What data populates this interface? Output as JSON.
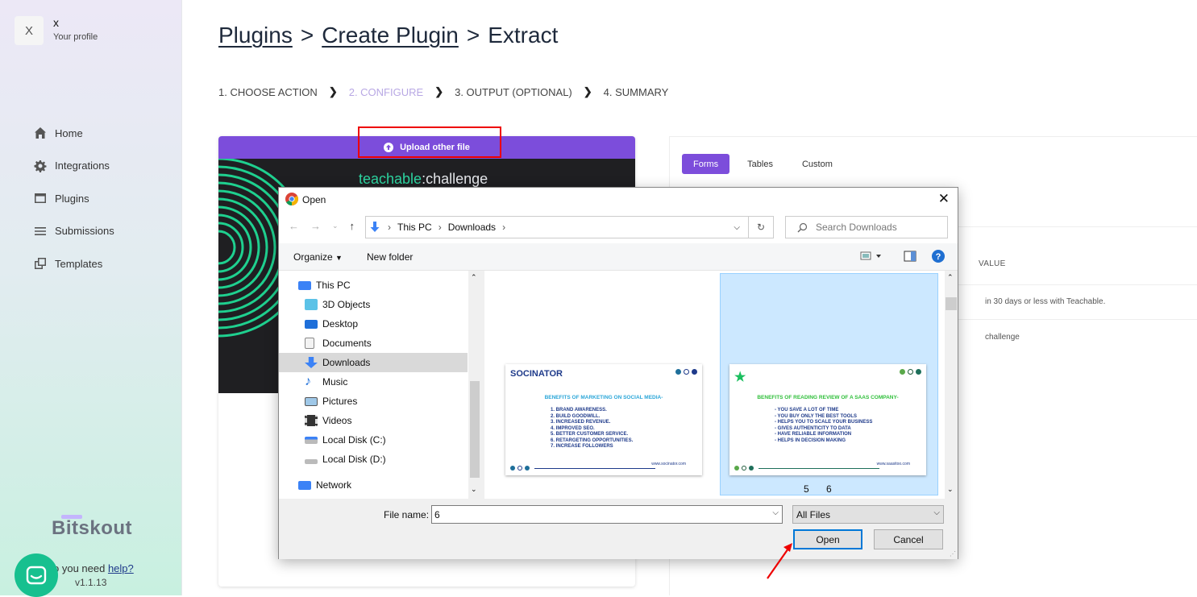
{
  "profile": {
    "initial": "X",
    "name": "x",
    "subtitle": "Your profile"
  },
  "nav": [
    {
      "label": "Home",
      "icon": "home-icon"
    },
    {
      "label": "Integrations",
      "icon": "gear-icon"
    },
    {
      "label": "Plugins",
      "icon": "window-icon"
    },
    {
      "label": "Submissions",
      "icon": "list-icon"
    },
    {
      "label": "Templates",
      "icon": "copy-icon"
    }
  ],
  "brand": "Bitskout",
  "help": {
    "prefix": "o you need ",
    "link": "help?",
    "version": "v1.1.13"
  },
  "breadcrumb": {
    "plugins": "Plugins",
    "create": "Create Plugin",
    "current": "Extract",
    "sep": ">"
  },
  "steps": [
    "1. CHOOSE ACTION",
    "2. CONFIGURE",
    "3. OUTPUT (OPTIONAL)",
    "4. SUMMARY"
  ],
  "upload_label": "Upload other file",
  "preview_title": {
    "brand": "teachable",
    "rest": ":challenge"
  },
  "right_tabs": [
    "Forms",
    "Tables",
    "Custom"
  ],
  "value_header": "VALUE",
  "value_rows": [
    "in 30 days or less with Teachable.",
    "challenge"
  ],
  "dialog": {
    "title": "Open",
    "path": [
      "This PC",
      "Downloads"
    ],
    "search_placeholder": "Search Downloads",
    "organize": "Organize",
    "new_folder": "New folder",
    "tree": [
      "This PC",
      "3D Objects",
      "Desktop",
      "Documents",
      "Downloads",
      "Music",
      "Pictures",
      "Videos",
      "Local Disk (C:)",
      "Local Disk (D:)",
      "Network"
    ],
    "files": [
      {
        "name": "5",
        "logo": "SOCINATOR",
        "heading": "BENEFITS OF MARKETING ON SOCIAL MEDIA-",
        "items": [
          "1. BRAND AWARENESS.",
          "2. BUILD GOODWILL.",
          "3. INCREASED REVENUE.",
          "4. IMPROVED SEO.",
          "5. BETTER CUSTOMER SERVICE.",
          "6. RETARGETING OPPORTUNITIES.",
          "7. INCREASE FOLLOWERS"
        ],
        "url": "www.socinator.com"
      },
      {
        "name": "6",
        "logo": "",
        "heading": "BENEFITS OF READING REVIEW OF A SAAS COMPANY-",
        "items": [
          "- YOU SAVE A LOT OF TIME",
          "- YOU BUY ONLY THE BEST TOOLS",
          "- HELPS YOU TO SCALE YOUR BUSINESS",
          "- GIVES AUTHENTICITY TO DATA",
          "- HAVE RELIABLE INFORMATION",
          "- HELPS IN DECISION MAKING"
        ],
        "url": "www.saasitoo.com"
      }
    ],
    "file_name_label": "File name:",
    "file_name_value": "6",
    "file_type": "All Files",
    "open": "Open",
    "cancel": "Cancel"
  }
}
